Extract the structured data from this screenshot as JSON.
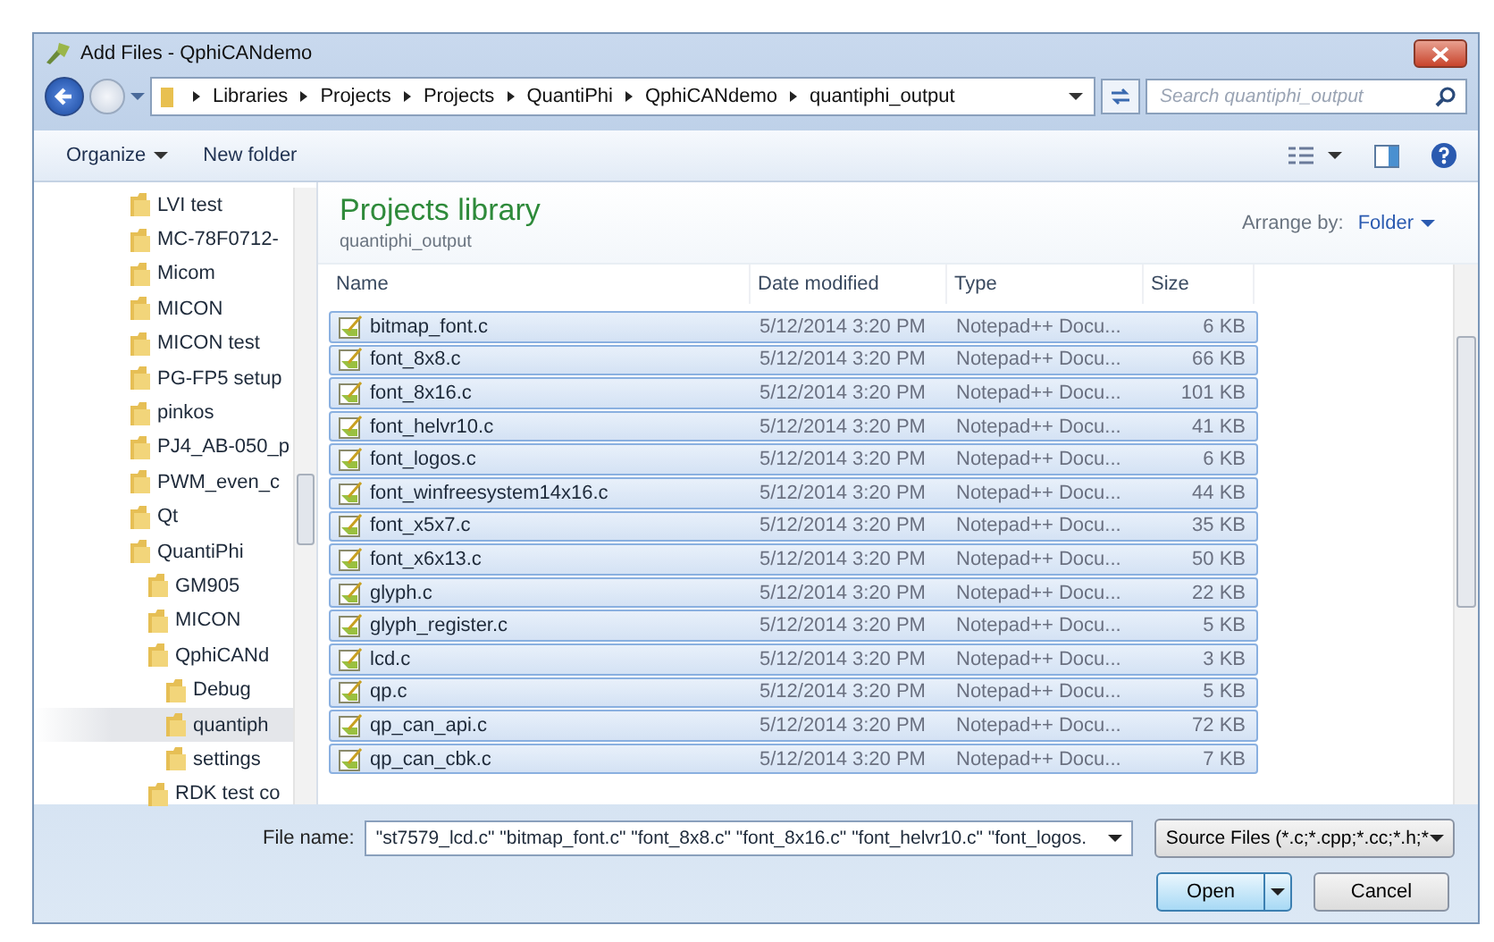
{
  "window": {
    "title": "Add Files - QphiCANdemo"
  },
  "address": {
    "crumbs": [
      "Libraries",
      "Projects",
      "Projects",
      "QuantiPhi",
      "QphiCANdemo",
      "quantiphi_output"
    ]
  },
  "search": {
    "placeholder": "Search quantiphi_output"
  },
  "toolbar": {
    "organize": "Organize",
    "new_folder": "New folder"
  },
  "sidebar": {
    "items": [
      {
        "label": "LVI test",
        "selected": false
      },
      {
        "label": "MC-78F0712-",
        "selected": false
      },
      {
        "label": "Micom",
        "selected": false
      },
      {
        "label": "MICON",
        "selected": false
      },
      {
        "label": "MICON test",
        "selected": false
      },
      {
        "label": "PG-FP5 setup",
        "selected": false
      },
      {
        "label": "pinkos",
        "selected": false
      },
      {
        "label": "PJ4_AB-050_p",
        "selected": false
      },
      {
        "label": "PWM_even_c",
        "selected": false
      },
      {
        "label": "Qt",
        "selected": false
      },
      {
        "label": "QuantiPhi",
        "selected": false,
        "children": [
          {
            "label": "GM905",
            "selected": false
          },
          {
            "label": "MICON",
            "selected": false
          },
          {
            "label": "QphiCANd",
            "selected": false,
            "children": [
              {
                "label": "Debug",
                "selected": false
              },
              {
                "label": "quantiph",
                "selected": true
              },
              {
                "label": "settings",
                "selected": false
              }
            ]
          },
          {
            "label": "RDK test co",
            "selected": false
          }
        ]
      }
    ]
  },
  "library": {
    "title": "Projects library",
    "subtitle": "quantiphi_output",
    "arrange_label": "Arrange by:",
    "arrange_value": "Folder"
  },
  "table": {
    "columns": [
      "Name",
      "Date modified",
      "Type",
      "Size"
    ],
    "rows": [
      {
        "name": "bitmap_font.c",
        "date": "5/12/2014 3:20 PM",
        "type": "Notepad++ Docu...",
        "size": "6 KB",
        "selected": true
      },
      {
        "name": "font_8x8.c",
        "date": "5/12/2014 3:20 PM",
        "type": "Notepad++ Docu...",
        "size": "66 KB",
        "selected": true
      },
      {
        "name": "font_8x16.c",
        "date": "5/12/2014 3:20 PM",
        "type": "Notepad++ Docu...",
        "size": "101 KB",
        "selected": true
      },
      {
        "name": "font_helvr10.c",
        "date": "5/12/2014 3:20 PM",
        "type": "Notepad++ Docu...",
        "size": "41 KB",
        "selected": true
      },
      {
        "name": "font_logos.c",
        "date": "5/12/2014 3:20 PM",
        "type": "Notepad++ Docu...",
        "size": "6 KB",
        "selected": true
      },
      {
        "name": "font_winfreesystem14x16.c",
        "date": "5/12/2014 3:20 PM",
        "type": "Notepad++ Docu...",
        "size": "44 KB",
        "selected": true
      },
      {
        "name": "font_x5x7.c",
        "date": "5/12/2014 3:20 PM",
        "type": "Notepad++ Docu...",
        "size": "35 KB",
        "selected": true
      },
      {
        "name": "font_x6x13.c",
        "date": "5/12/2014 3:20 PM",
        "type": "Notepad++ Docu...",
        "size": "50 KB",
        "selected": true
      },
      {
        "name": "glyph.c",
        "date": "5/12/2014 3:20 PM",
        "type": "Notepad++ Docu...",
        "size": "22 KB",
        "selected": true
      },
      {
        "name": "glyph_register.c",
        "date": "5/12/2014 3:20 PM",
        "type": "Notepad++ Docu...",
        "size": "5 KB",
        "selected": true
      },
      {
        "name": "lcd.c",
        "date": "5/12/2014 3:20 PM",
        "type": "Notepad++ Docu...",
        "size": "3 KB",
        "selected": true
      },
      {
        "name": "qp.c",
        "date": "5/12/2014 3:20 PM",
        "type": "Notepad++ Docu...",
        "size": "5 KB",
        "selected": true
      },
      {
        "name": "qp_can_api.c",
        "date": "5/12/2014 3:20 PM",
        "type": "Notepad++ Docu...",
        "size": "72 KB",
        "selected": true
      },
      {
        "name": "qp_can_cbk.c",
        "date": "5/12/2014 3:20 PM",
        "type": "Notepad++ Docu...",
        "size": "7 KB",
        "selected": true
      }
    ]
  },
  "file_name": {
    "label": "File name:",
    "value": "\"st7579_lcd.c\" \"bitmap_font.c\" \"font_8x8.c\" \"font_8x16.c\" \"font_helvr10.c\" \"font_logos."
  },
  "filter": {
    "value": "Source Files (*.c;*.cpp;*.cc;*.h;*"
  },
  "buttons": {
    "open": "Open",
    "cancel": "Cancel"
  }
}
